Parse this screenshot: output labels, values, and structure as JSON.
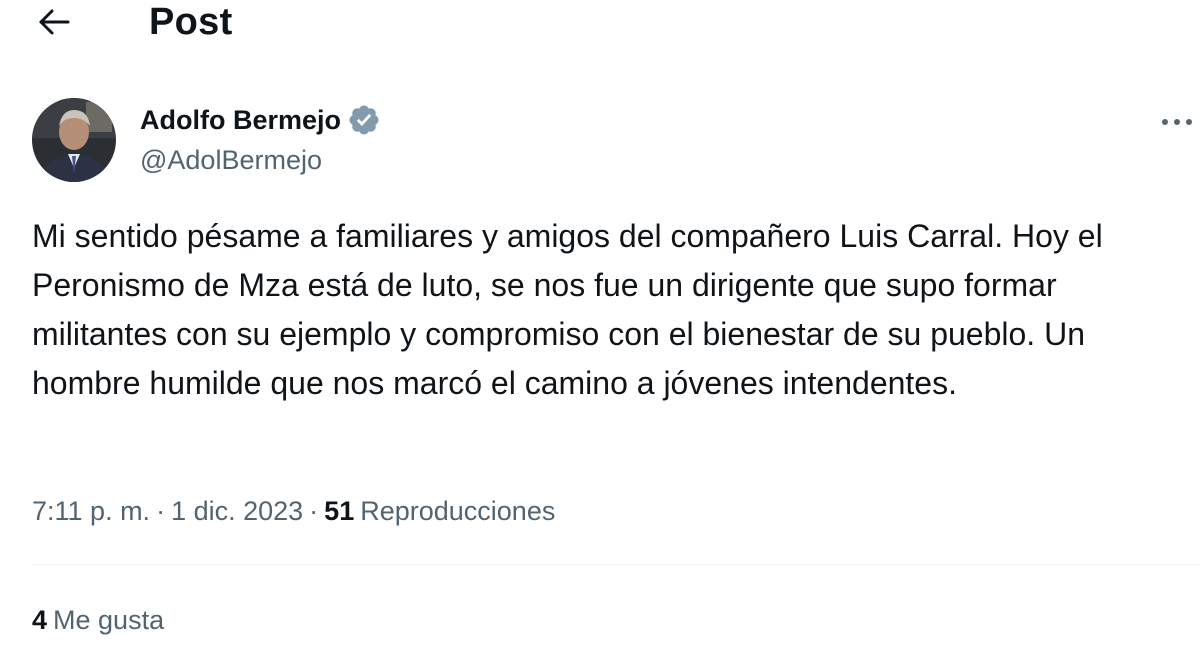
{
  "header": {
    "title": "Post",
    "back_icon": "arrow-left-icon"
  },
  "author": {
    "name": "Adolfo Bermejo",
    "handle": "@AdolBermejo",
    "verified_icon": "verified-badge-icon",
    "verified_color": "#829aab",
    "more_icon": "more-horizontal-icon"
  },
  "post": {
    "text": "Mi sentido pésame a familiares y amigos del compañero Luis Carral. Hoy el Peronismo de Mza está de luto, se nos fue un dirigente que supo formar militantes con su ejemplo y compromiso con el bienestar de su pueblo. Un hombre humilde que nos marcó el camino a jóvenes intendentes."
  },
  "meta": {
    "time": "7:11 p. m.",
    "separator": "·",
    "date": "1 dic. 2023",
    "views_count": "51",
    "views_label": "Reproducciones"
  },
  "engagement": {
    "likes_count": "4",
    "likes_label": "Me gusta"
  },
  "colors": {
    "text_primary": "#0f1419",
    "text_secondary": "#536471",
    "divider": "#eff3f4"
  }
}
